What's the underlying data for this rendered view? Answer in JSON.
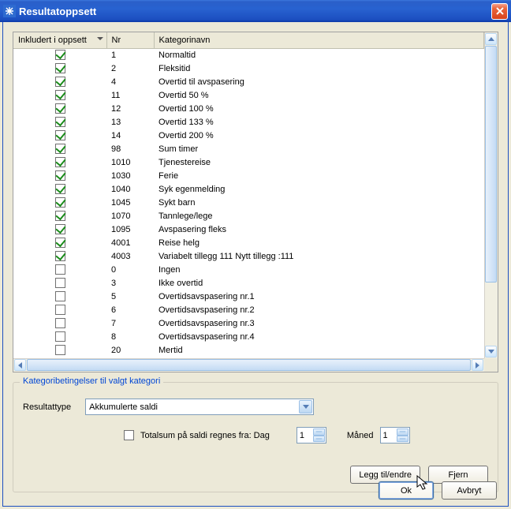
{
  "window": {
    "title": "Resultatoppsett"
  },
  "grid": {
    "headers": {
      "included": "Inkludert i oppsett",
      "nr": "Nr",
      "name": "Kategorinavn"
    },
    "rows": [
      {
        "checked": true,
        "nr": "1",
        "name": "Normaltid"
      },
      {
        "checked": true,
        "nr": "2",
        "name": "Fleksitid"
      },
      {
        "checked": true,
        "nr": "4",
        "name": "Overtid til avspasering"
      },
      {
        "checked": true,
        "nr": "11",
        "name": "Overtid 50 %"
      },
      {
        "checked": true,
        "nr": "12",
        "name": "Overtid 100 %"
      },
      {
        "checked": true,
        "nr": "13",
        "name": "Overtid 133 %"
      },
      {
        "checked": true,
        "nr": "14",
        "name": "Overtid 200 %"
      },
      {
        "checked": true,
        "nr": "98",
        "name": "Sum timer"
      },
      {
        "checked": true,
        "nr": "1010",
        "name": "Tjenestereise"
      },
      {
        "checked": true,
        "nr": "1030",
        "name": "Ferie"
      },
      {
        "checked": true,
        "nr": "1040",
        "name": "Syk egenmelding"
      },
      {
        "checked": true,
        "nr": "1045",
        "name": "Sykt barn"
      },
      {
        "checked": true,
        "nr": "1070",
        "name": "Tannlege/lege"
      },
      {
        "checked": true,
        "nr": "1095",
        "name": "Avspasering fleks"
      },
      {
        "checked": true,
        "nr": "4001",
        "name": "Reise helg"
      },
      {
        "checked": true,
        "nr": "4003",
        "name": "Variabelt tillegg 111 Nytt tillegg :111"
      },
      {
        "checked": false,
        "nr": "0",
        "name": "Ingen"
      },
      {
        "checked": false,
        "nr": "3",
        "name": "Ikke overtid"
      },
      {
        "checked": false,
        "nr": "5",
        "name": "Overtidsavspasering nr.1"
      },
      {
        "checked": false,
        "nr": "6",
        "name": "Overtidsavspasering nr.2"
      },
      {
        "checked": false,
        "nr": "7",
        "name": "Overtidsavspasering nr.3"
      },
      {
        "checked": false,
        "nr": "8",
        "name": "Overtidsavspasering nr.4"
      },
      {
        "checked": false,
        "nr": "20",
        "name": "Mertid"
      }
    ]
  },
  "group": {
    "legend": "Kategoribetingelser til valgt kategori",
    "resultType": {
      "label": "Resultattype",
      "value": "Akkumulerte saldi"
    },
    "totalsum": {
      "checked": false,
      "label": "Totalsum på saldi regnes fra: Dag"
    },
    "spin1": "1",
    "monthLabel": "Måned",
    "spin2": "1",
    "addEdit": "Legg til/endre",
    "remove": "Fjern"
  },
  "buttons": {
    "ok": "Ok",
    "cancel": "Avbryt"
  }
}
